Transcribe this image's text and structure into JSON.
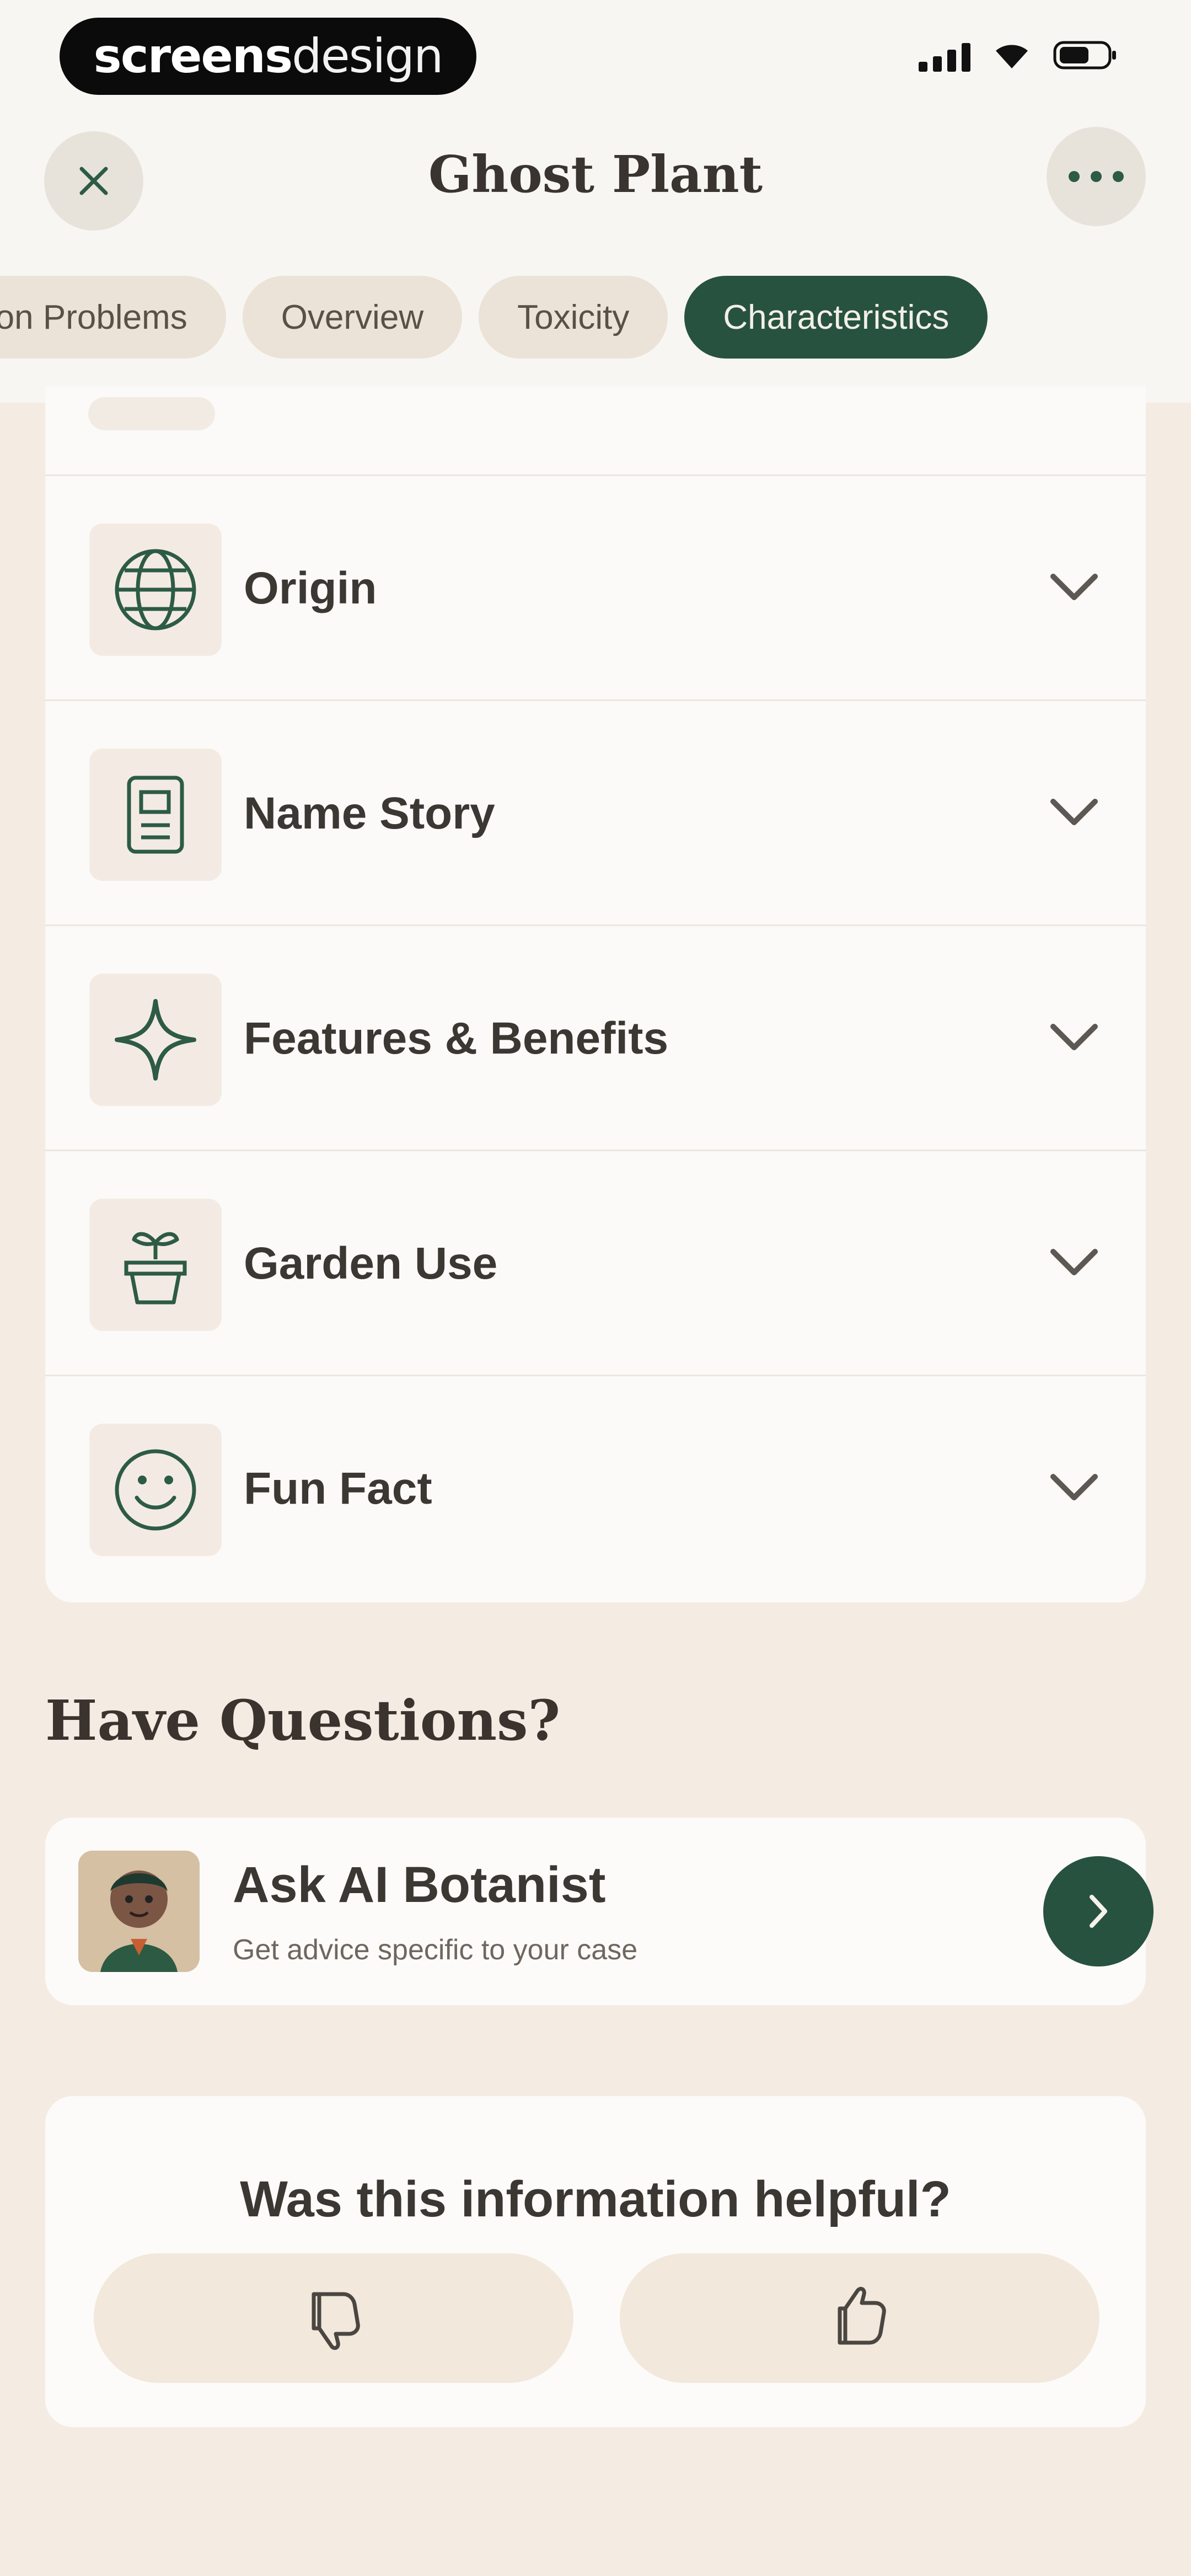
{
  "app": {
    "brand_prefix": "screens",
    "brand_suffix": "design"
  },
  "header": {
    "title": "Ghost Plant"
  },
  "tabs": [
    {
      "label": "mon Problems",
      "active": false
    },
    {
      "label": "Overview",
      "active": false
    },
    {
      "label": "Toxicity",
      "active": false
    },
    {
      "label": "Characteristics",
      "active": true
    }
  ],
  "sections": [
    {
      "label": "Origin",
      "icon": "globe-icon"
    },
    {
      "label": "Name Story",
      "icon": "document-icon"
    },
    {
      "label": "Features & Benefits",
      "icon": "sparkle-icon"
    },
    {
      "label": "Garden Use",
      "icon": "plant-pot-icon"
    },
    {
      "label": "Fun Fact",
      "icon": "smile-icon"
    }
  ],
  "questions": {
    "title": "Have Questions?",
    "ai_title": "Ask AI Botanist",
    "ai_subtitle": "Get advice specific to your case"
  },
  "feedback": {
    "question": "Was this information helpful?"
  },
  "colors": {
    "accent": "#275240",
    "background": "#f4ebe3",
    "card": "#fbfaf8"
  }
}
